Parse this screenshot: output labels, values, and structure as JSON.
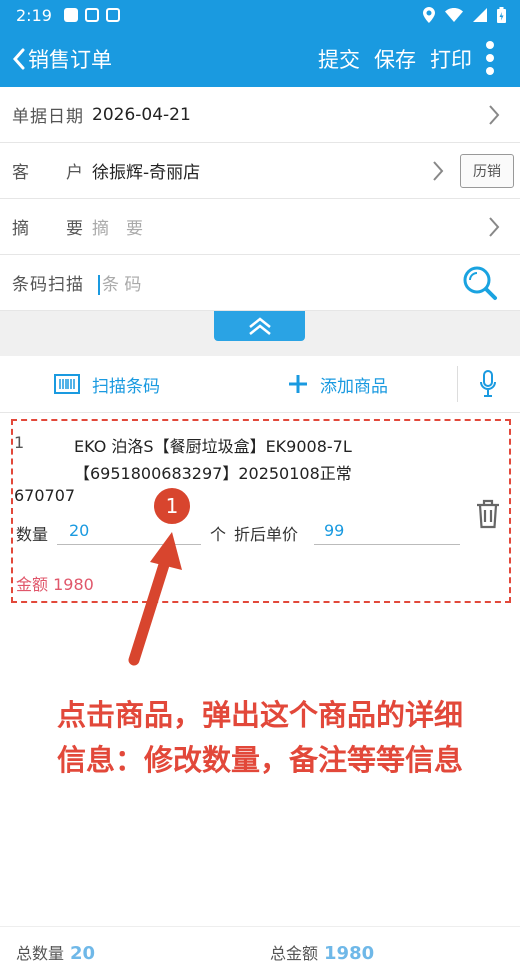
{
  "status": {
    "time": "2:19"
  },
  "header": {
    "title": "销售订单",
    "actions": [
      "提交",
      "保存",
      "打印"
    ]
  },
  "form": {
    "date_label": "单据日期",
    "date_value": "2026-04-21",
    "customer_label_a": "客",
    "customer_label_b": "户",
    "customer_value": "徐振辉-奇丽店",
    "history_btn": "历销",
    "memo_label_a": "摘",
    "memo_label_b": "要",
    "memo_placeholder": "摘　要",
    "barcode_label": "条码扫描",
    "barcode_placeholder": "条  码"
  },
  "toolbar": {
    "scan_label": "扫描条码",
    "add_label": "添加商品"
  },
  "item": {
    "index": "1",
    "name_line1": "EKO 泊洛S【餐厨垃圾盒】EK9008-7L",
    "name_line2": "【6951800683297】20250108正常",
    "name_line3": "670707",
    "qty_label": "数量",
    "qty_value": "20",
    "unit": "个",
    "price_label": "折后单价",
    "price_value": "99",
    "amount_label": "金额",
    "amount_value": "1980"
  },
  "annotation": {
    "badge": "1",
    "callout_line1": "点击商品，弹出这个商品的详细",
    "callout_line2": "信息：修改数量，备注等等信息",
    "color": "#e2483a"
  },
  "footer": {
    "total_qty_label": "总数量",
    "total_qty_value": "20",
    "total_amount_label": "总金额",
    "total_amount_value": "1980"
  },
  "colors": {
    "primary": "#1a9ae0",
    "amount": "#e0576b"
  }
}
